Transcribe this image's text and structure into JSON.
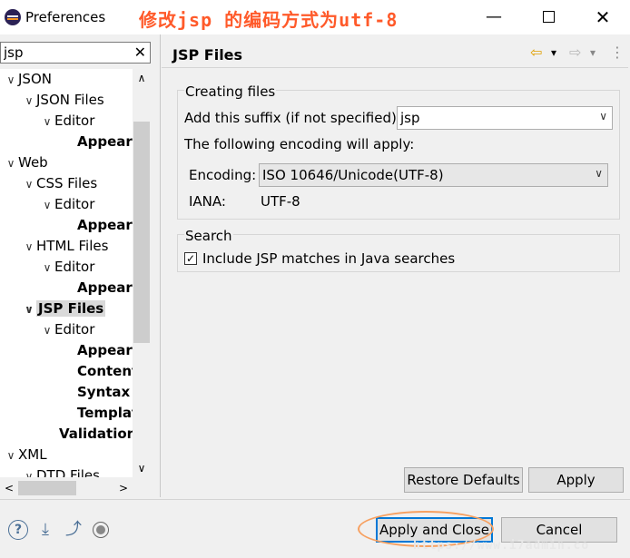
{
  "window": {
    "title": "Preferences",
    "annotation": "修改jsp 的编码方式为utf-8",
    "minimize": "—",
    "close": "✕"
  },
  "filter": {
    "value": "jsp",
    "clear": "✕"
  },
  "tree": {
    "items": [
      {
        "label": "JSON",
        "twisty": "∨"
      },
      {
        "label": "JSON Files",
        "twisty": "∨"
      },
      {
        "label": "Editor",
        "twisty": "∨"
      },
      {
        "label": "Appeara"
      },
      {
        "label": "Web",
        "twisty": "∨"
      },
      {
        "label": "CSS Files",
        "twisty": "∨"
      },
      {
        "label": "Editor",
        "twisty": "∨"
      },
      {
        "label": "Appeara"
      },
      {
        "label": "HTML Files",
        "twisty": "∨"
      },
      {
        "label": "Editor",
        "twisty": "∨"
      },
      {
        "label": "Appeara"
      },
      {
        "label": "JSP Files",
        "twisty": "∨"
      },
      {
        "label": "Editor",
        "twisty": "∨"
      },
      {
        "label": "Appeara"
      },
      {
        "label": "Content"
      },
      {
        "label": "Syntax C"
      },
      {
        "label": "Templat"
      },
      {
        "label": "Validation"
      },
      {
        "label": "XML",
        "twisty": "∨"
      },
      {
        "label": "DTD Files",
        "twisty": "∨"
      }
    ]
  },
  "scrollbars": {
    "up": "∧",
    "down": "∨",
    "left": "<",
    "right": ">"
  },
  "page": {
    "title": "JSP Files",
    "nav": {
      "back": "⇦",
      "back_menu": "▾",
      "forward": "⇨",
      "forward_menu": "▾",
      "more": "⋮"
    },
    "creating_files": {
      "group_label": "Creating files",
      "suffix_label": "Add this suffix (if not specified):",
      "suffix_value": "jsp",
      "encoding_intro": "The following encoding will apply:",
      "encoding_label": "Encoding:",
      "encoding_value": "ISO 10646/Unicode(UTF-8)",
      "iana_label": "IANA:",
      "iana_value": "UTF-8"
    },
    "search": {
      "group_label": "Search",
      "checkbox_label": "Include JSP matches in Java searches",
      "checked": true,
      "check_mark": "✓"
    },
    "restore_defaults": "Restore Defaults",
    "apply": "Apply"
  },
  "footer": {
    "help": "?",
    "import": "⤓",
    "export": "⤴",
    "apply_close": "Apply and Close",
    "cancel": "Cancel",
    "watermark": "https://www.i7admin.co"
  },
  "colors": {
    "annotation": "#ff5a2a",
    "accent": "#0078d7",
    "selection": "#d9d9d9"
  }
}
